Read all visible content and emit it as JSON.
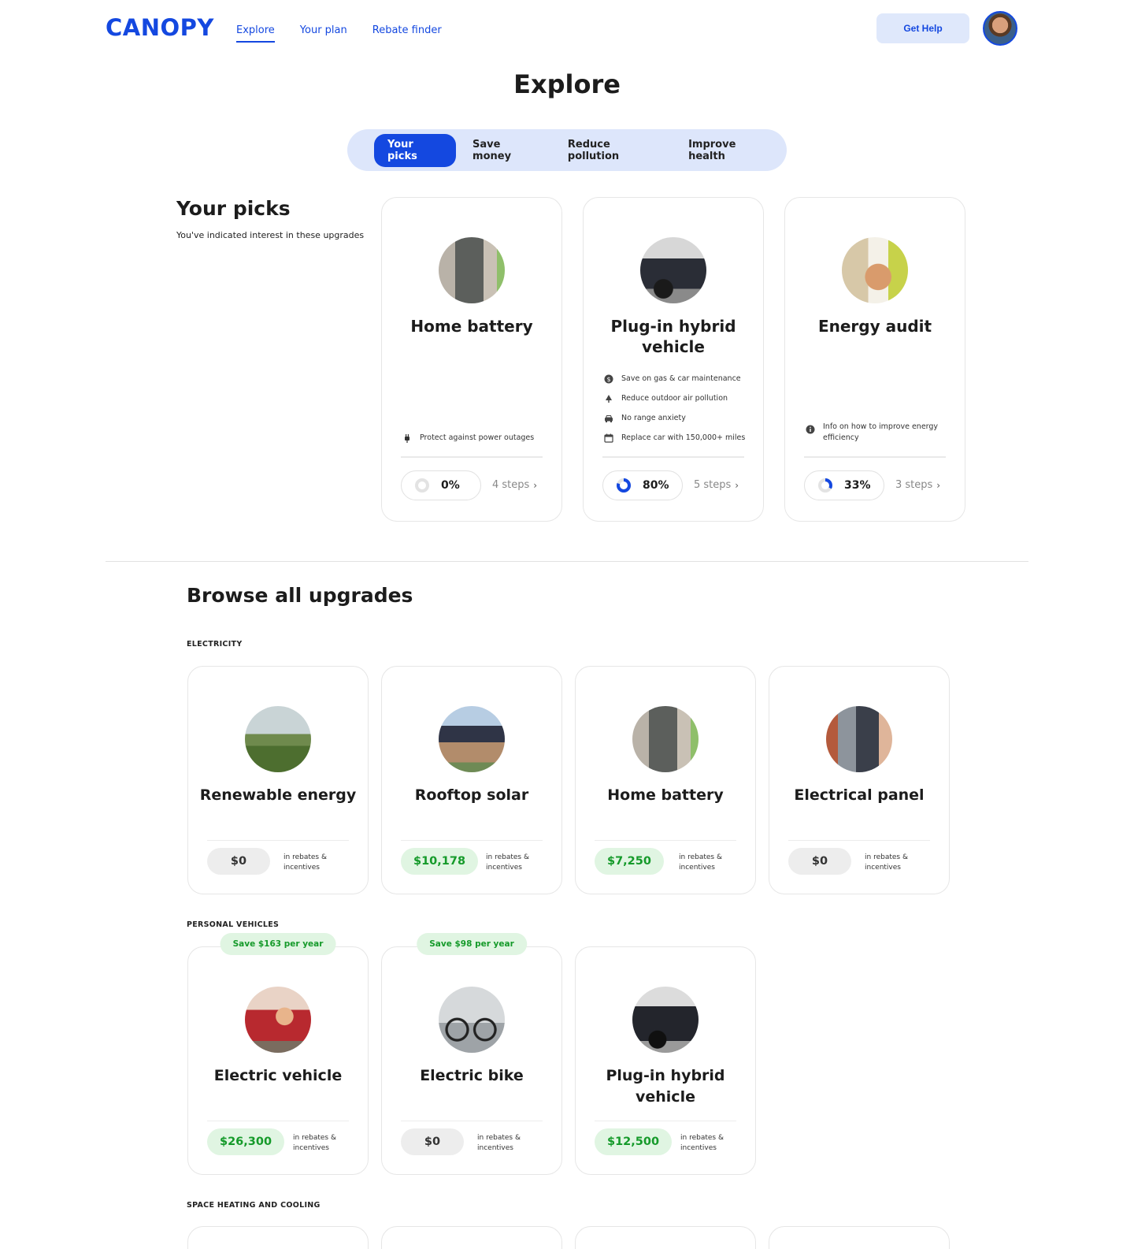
{
  "header": {
    "logo": "CANOPY",
    "nav": [
      "Explore",
      "Your plan",
      "Rebate finder"
    ],
    "help_label": "Get Help"
  },
  "page_title": "Explore",
  "filters": [
    "Your picks",
    "Save money",
    "Reduce pollution",
    "Improve health"
  ],
  "picks": {
    "title": "Your picks",
    "subtitle": "You've indicated interest in these upgrades",
    "cards": [
      {
        "title": "Home battery",
        "image_icon": "home-battery-photo",
        "features": [
          {
            "icon": "plug-icon",
            "text": "Protect against power outages"
          }
        ],
        "progress": "0%",
        "progress_fraction": 0,
        "steps": "4 steps"
      },
      {
        "title": "Plug-in hybrid vehicle",
        "image_icon": "plug-in-hybrid-photo",
        "features": [
          {
            "icon": "dollar-icon",
            "text": "Save on gas & car maintenance"
          },
          {
            "icon": "tree-icon",
            "text": "Reduce outdoor air pollution"
          },
          {
            "icon": "car-icon",
            "text": "No range anxiety"
          },
          {
            "icon": "calendar-icon",
            "text": "Replace car with 150,000+ miles"
          }
        ],
        "progress": "80%",
        "progress_fraction": 0.8,
        "steps": "5 steps"
      },
      {
        "title": "Energy audit",
        "image_icon": "energy-audit-photo",
        "features": [
          {
            "icon": "info-icon",
            "text": "Info on how to improve energy efficiency"
          }
        ],
        "progress": "33%",
        "progress_fraction": 0.33,
        "steps": "3 steps"
      }
    ]
  },
  "browse": {
    "title": "Browse all upgrades",
    "rebate_note": "in rebates & incentives",
    "sections": [
      {
        "label": "ELECTRICITY",
        "cards": [
          {
            "title": "Renewable energy",
            "image_icon": "wind-turbine-photo",
            "amount": "$0",
            "positive": false
          },
          {
            "title": "Rooftop solar",
            "image_icon": "rooftop-solar-photo",
            "amount": "$10,178",
            "positive": true
          },
          {
            "title": "Home battery",
            "image_icon": "home-battery-photo",
            "amount": "$7,250",
            "positive": true
          },
          {
            "title": "Electrical panel",
            "image_icon": "electrical-panel-photo",
            "amount": "$0",
            "positive": false
          }
        ]
      },
      {
        "label": "PERSONAL VEHICLES",
        "cards": [
          {
            "title": "Electric vehicle",
            "image_icon": "electric-vehicle-photo",
            "amount": "$26,300",
            "positive": true,
            "badge": "Save $163 per year"
          },
          {
            "title": "Electric bike",
            "image_icon": "electric-bike-photo",
            "amount": "$0",
            "positive": false,
            "badge": "Save $98 per year"
          },
          {
            "title": "Plug-in hybrid vehicle",
            "image_icon": "plug-in-hybrid-photo",
            "amount": "$12,500",
            "positive": true
          }
        ]
      },
      {
        "label": "SPACE HEATING AND COOLING",
        "cards": []
      }
    ]
  },
  "colors": {
    "brand": "#1448e0",
    "brand_light": "#dde6fb",
    "savings_green": "#159a2a",
    "savings_bg": "#e0f5e2"
  }
}
